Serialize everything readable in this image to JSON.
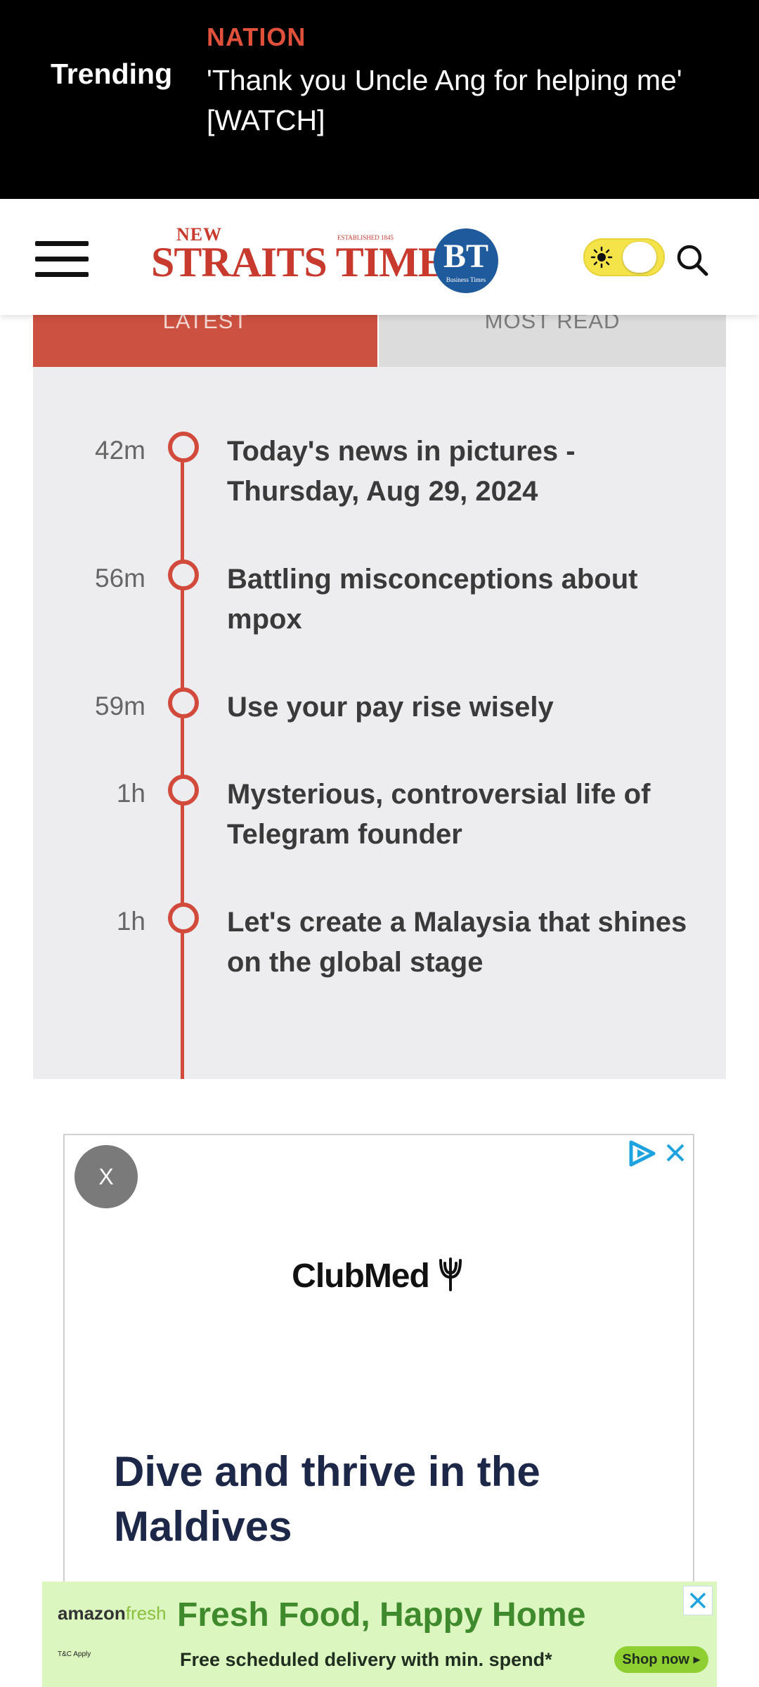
{
  "trending": {
    "label": "Trending",
    "category": "NATION",
    "headline": "'Thank you Uncle Ang for helping me' [WATCH]"
  },
  "header": {
    "logo_new": "NEW",
    "logo_est": "ESTABLISHED 1845",
    "logo_main": "STRAITS TIMES",
    "bt_logo": "BT",
    "bt_sub": "Business Times"
  },
  "tabs": {
    "latest": "LATEST",
    "most_read": "MOST READ"
  },
  "timeline": [
    {
      "time": "42m",
      "title": "Today's news in pictures - Thursday, Aug 29, 2024"
    },
    {
      "time": "56m",
      "title": "Battling misconceptions about mpox"
    },
    {
      "time": "59m",
      "title": "Use your pay rise wisely"
    },
    {
      "time": "1h",
      "title": "Mysterious, controversial life of Telegram founder"
    },
    {
      "time": "1h",
      "title": "Let's create a Malaysia that shines on the global stage"
    }
  ],
  "ad": {
    "close_label": "X",
    "brand": "ClubMed",
    "headline": "Dive and thrive in the Maldives"
  },
  "banner": {
    "logo_amazon": "amazon",
    "logo_fresh": "fresh",
    "fine_print": "T&C Apply",
    "headline": "Fresh Food, Happy Home",
    "subline": "Free scheduled delivery with min. spend*",
    "cta": "Shop now ▸"
  },
  "colors": {
    "accent_red": "#d14a3b",
    "trending_bg": "#000000",
    "panel_bg": "#ededf0",
    "ad_headline": "#1d2848",
    "banner_bg": "#dcf6c0"
  }
}
